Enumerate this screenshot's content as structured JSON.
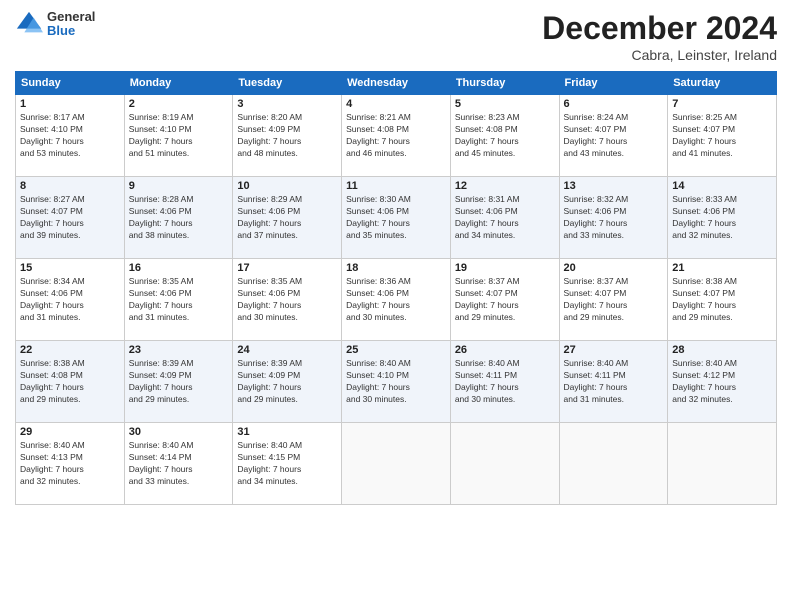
{
  "logo": {
    "general": "General",
    "blue": "Blue"
  },
  "header": {
    "month": "December 2024",
    "location": "Cabra, Leinster, Ireland"
  },
  "weekdays": [
    "Sunday",
    "Monday",
    "Tuesday",
    "Wednesday",
    "Thursday",
    "Friday",
    "Saturday"
  ],
  "weeks": [
    [
      {
        "day": "1",
        "sunrise": "8:17 AM",
        "sunset": "4:10 PM",
        "daylight": "7 hours and 53 minutes."
      },
      {
        "day": "2",
        "sunrise": "8:19 AM",
        "sunset": "4:10 PM",
        "daylight": "7 hours and 51 minutes."
      },
      {
        "day": "3",
        "sunrise": "8:20 AM",
        "sunset": "4:09 PM",
        "daylight": "7 hours and 48 minutes."
      },
      {
        "day": "4",
        "sunrise": "8:21 AM",
        "sunset": "4:08 PM",
        "daylight": "7 hours and 46 minutes."
      },
      {
        "day": "5",
        "sunrise": "8:23 AM",
        "sunset": "4:08 PM",
        "daylight": "7 hours and 45 minutes."
      },
      {
        "day": "6",
        "sunrise": "8:24 AM",
        "sunset": "4:07 PM",
        "daylight": "7 hours and 43 minutes."
      },
      {
        "day": "7",
        "sunrise": "8:25 AM",
        "sunset": "4:07 PM",
        "daylight": "7 hours and 41 minutes."
      }
    ],
    [
      {
        "day": "8",
        "sunrise": "8:27 AM",
        "sunset": "4:07 PM",
        "daylight": "7 hours and 39 minutes."
      },
      {
        "day": "9",
        "sunrise": "8:28 AM",
        "sunset": "4:06 PM",
        "daylight": "7 hours and 38 minutes."
      },
      {
        "day": "10",
        "sunrise": "8:29 AM",
        "sunset": "4:06 PM",
        "daylight": "7 hours and 37 minutes."
      },
      {
        "day": "11",
        "sunrise": "8:30 AM",
        "sunset": "4:06 PM",
        "daylight": "7 hours and 35 minutes."
      },
      {
        "day": "12",
        "sunrise": "8:31 AM",
        "sunset": "4:06 PM",
        "daylight": "7 hours and 34 minutes."
      },
      {
        "day": "13",
        "sunrise": "8:32 AM",
        "sunset": "4:06 PM",
        "daylight": "7 hours and 33 minutes."
      },
      {
        "day": "14",
        "sunrise": "8:33 AM",
        "sunset": "4:06 PM",
        "daylight": "7 hours and 32 minutes."
      }
    ],
    [
      {
        "day": "15",
        "sunrise": "8:34 AM",
        "sunset": "4:06 PM",
        "daylight": "7 hours and 31 minutes."
      },
      {
        "day": "16",
        "sunrise": "8:35 AM",
        "sunset": "4:06 PM",
        "daylight": "7 hours and 31 minutes."
      },
      {
        "day": "17",
        "sunrise": "8:35 AM",
        "sunset": "4:06 PM",
        "daylight": "7 hours and 30 minutes."
      },
      {
        "day": "18",
        "sunrise": "8:36 AM",
        "sunset": "4:06 PM",
        "daylight": "7 hours and 30 minutes."
      },
      {
        "day": "19",
        "sunrise": "8:37 AM",
        "sunset": "4:07 PM",
        "daylight": "7 hours and 29 minutes."
      },
      {
        "day": "20",
        "sunrise": "8:37 AM",
        "sunset": "4:07 PM",
        "daylight": "7 hours and 29 minutes."
      },
      {
        "day": "21",
        "sunrise": "8:38 AM",
        "sunset": "4:07 PM",
        "daylight": "7 hours and 29 minutes."
      }
    ],
    [
      {
        "day": "22",
        "sunrise": "8:38 AM",
        "sunset": "4:08 PM",
        "daylight": "7 hours and 29 minutes."
      },
      {
        "day": "23",
        "sunrise": "8:39 AM",
        "sunset": "4:09 PM",
        "daylight": "7 hours and 29 minutes."
      },
      {
        "day": "24",
        "sunrise": "8:39 AM",
        "sunset": "4:09 PM",
        "daylight": "7 hours and 29 minutes."
      },
      {
        "day": "25",
        "sunrise": "8:40 AM",
        "sunset": "4:10 PM",
        "daylight": "7 hours and 30 minutes."
      },
      {
        "day": "26",
        "sunrise": "8:40 AM",
        "sunset": "4:11 PM",
        "daylight": "7 hours and 30 minutes."
      },
      {
        "day": "27",
        "sunrise": "8:40 AM",
        "sunset": "4:11 PM",
        "daylight": "7 hours and 31 minutes."
      },
      {
        "day": "28",
        "sunrise": "8:40 AM",
        "sunset": "4:12 PM",
        "daylight": "7 hours and 32 minutes."
      }
    ],
    [
      {
        "day": "29",
        "sunrise": "8:40 AM",
        "sunset": "4:13 PM",
        "daylight": "7 hours and 32 minutes."
      },
      {
        "day": "30",
        "sunrise": "8:40 AM",
        "sunset": "4:14 PM",
        "daylight": "7 hours and 33 minutes."
      },
      {
        "day": "31",
        "sunrise": "8:40 AM",
        "sunset": "4:15 PM",
        "daylight": "7 hours and 34 minutes."
      },
      null,
      null,
      null,
      null
    ]
  ],
  "labels": {
    "sunrise": "Sunrise:",
    "sunset": "Sunset:",
    "daylight": "Daylight:"
  }
}
